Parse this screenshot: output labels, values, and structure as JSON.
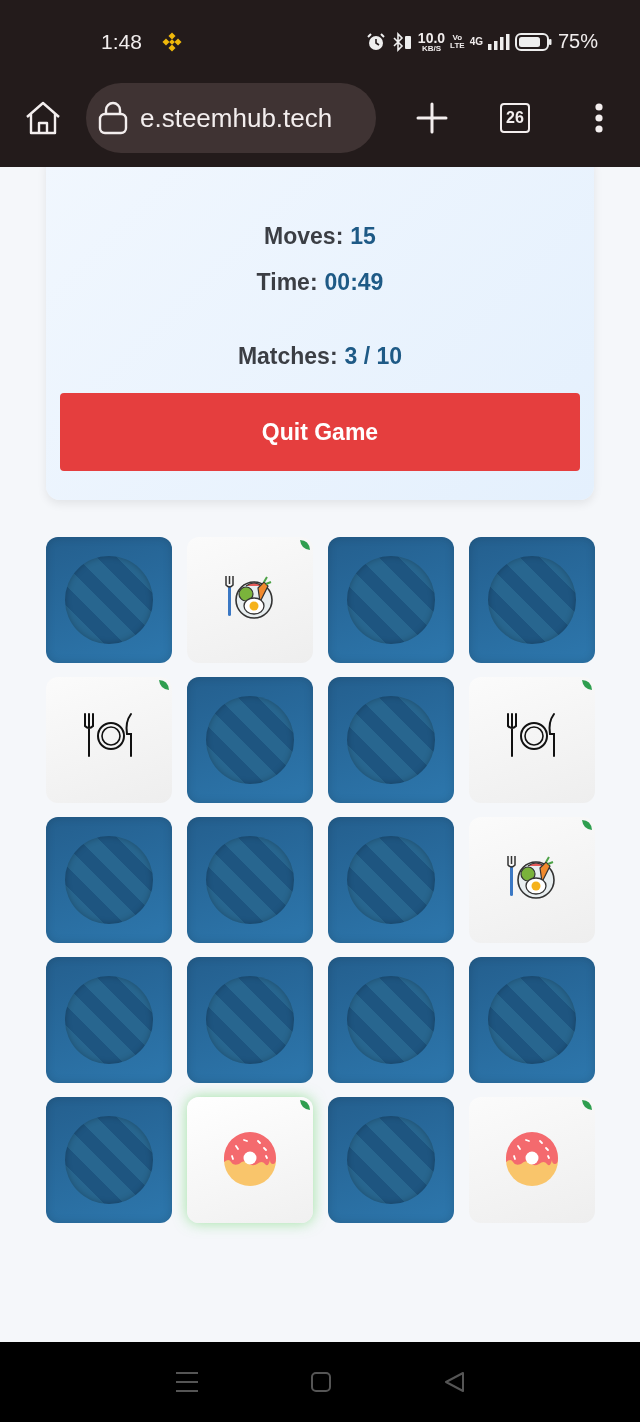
{
  "status_bar": {
    "time": "1:48",
    "speed_value": "10.0",
    "speed_unit": "KB/S",
    "volte_top": "Vo",
    "volte_bottom": "LTE",
    "network": "4G",
    "battery": "75%"
  },
  "browser_bar": {
    "url": "e.steemhub.tech",
    "tab_count": "26"
  },
  "game_info": {
    "stats": [
      {
        "label": "Moves:",
        "value": "15"
      },
      {
        "label": "Time:",
        "value": "00:49"
      },
      {
        "label": "Matches:",
        "value": "3 / 10"
      }
    ],
    "quit_button": "Quit Game"
  },
  "cards": [
    {
      "kind": "back"
    },
    {
      "kind": "salad",
      "matched": true,
      "glow": false
    },
    {
      "kind": "back"
    },
    {
      "kind": "back"
    },
    {
      "kind": "cutlery",
      "matched": true,
      "glow": false
    },
    {
      "kind": "back"
    },
    {
      "kind": "back"
    },
    {
      "kind": "cutlery",
      "matched": true,
      "glow": false
    },
    {
      "kind": "back"
    },
    {
      "kind": "back"
    },
    {
      "kind": "back"
    },
    {
      "kind": "salad",
      "matched": true,
      "glow": false
    },
    {
      "kind": "back"
    },
    {
      "kind": "back"
    },
    {
      "kind": "back"
    },
    {
      "kind": "back"
    },
    {
      "kind": "back"
    },
    {
      "kind": "donut",
      "matched": true,
      "glow": true
    },
    {
      "kind": "back"
    },
    {
      "kind": "donut",
      "matched": true,
      "glow": false
    }
  ]
}
